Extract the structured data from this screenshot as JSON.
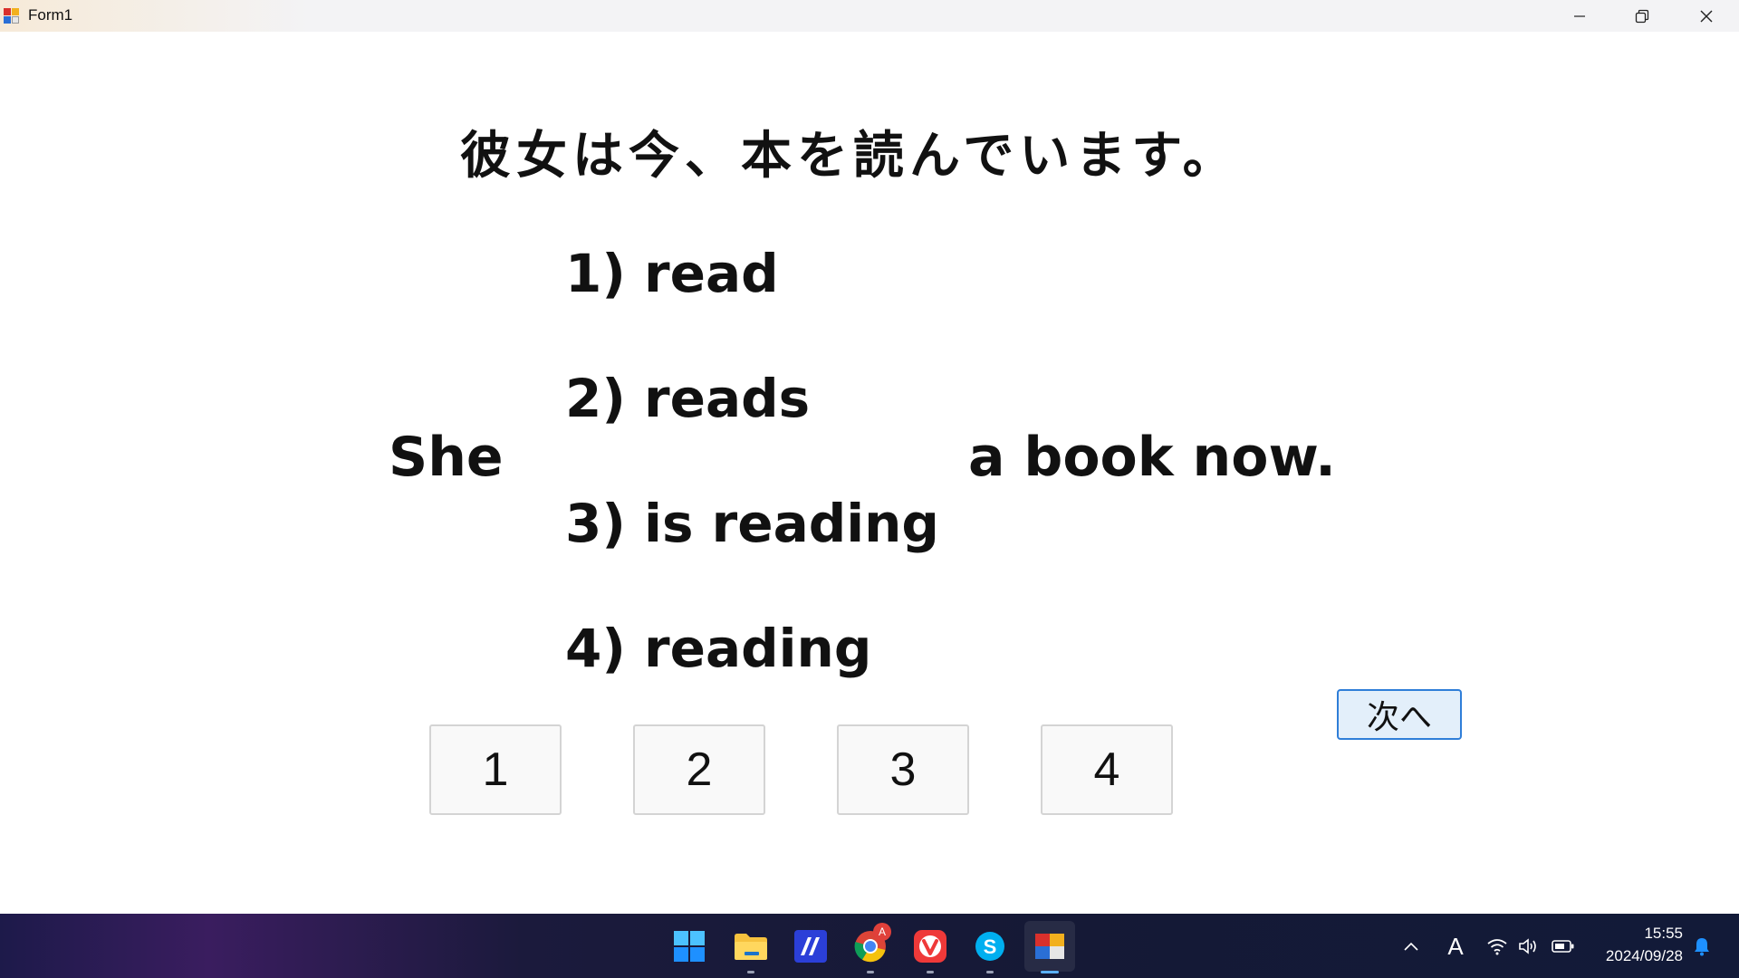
{
  "window": {
    "title": "Form1",
    "controls": [
      "minimize",
      "restore",
      "close"
    ]
  },
  "quiz": {
    "japanese_sentence": "彼女は今、本を読んでいます。",
    "sentence_start": "She",
    "sentence_end": "a book now.",
    "options": [
      "1) read",
      "2) reads",
      "3) is reading",
      "4) reading"
    ],
    "answer_buttons": [
      "1",
      "2",
      "3",
      "4"
    ],
    "next_button": "次へ"
  },
  "taskbar": {
    "apps": [
      "start",
      "file-explorer",
      "dev-app",
      "chrome",
      "vivaldi",
      "skype",
      "form-app"
    ],
    "chrome_badge": "A",
    "ime_indicator": "A",
    "time": "15:55",
    "date": "2024/09/28"
  },
  "colors": {
    "next_button_border": "#2f7ed8",
    "next_button_bg": "#e3effa",
    "taskbar_bg": "#1b1a3c"
  }
}
